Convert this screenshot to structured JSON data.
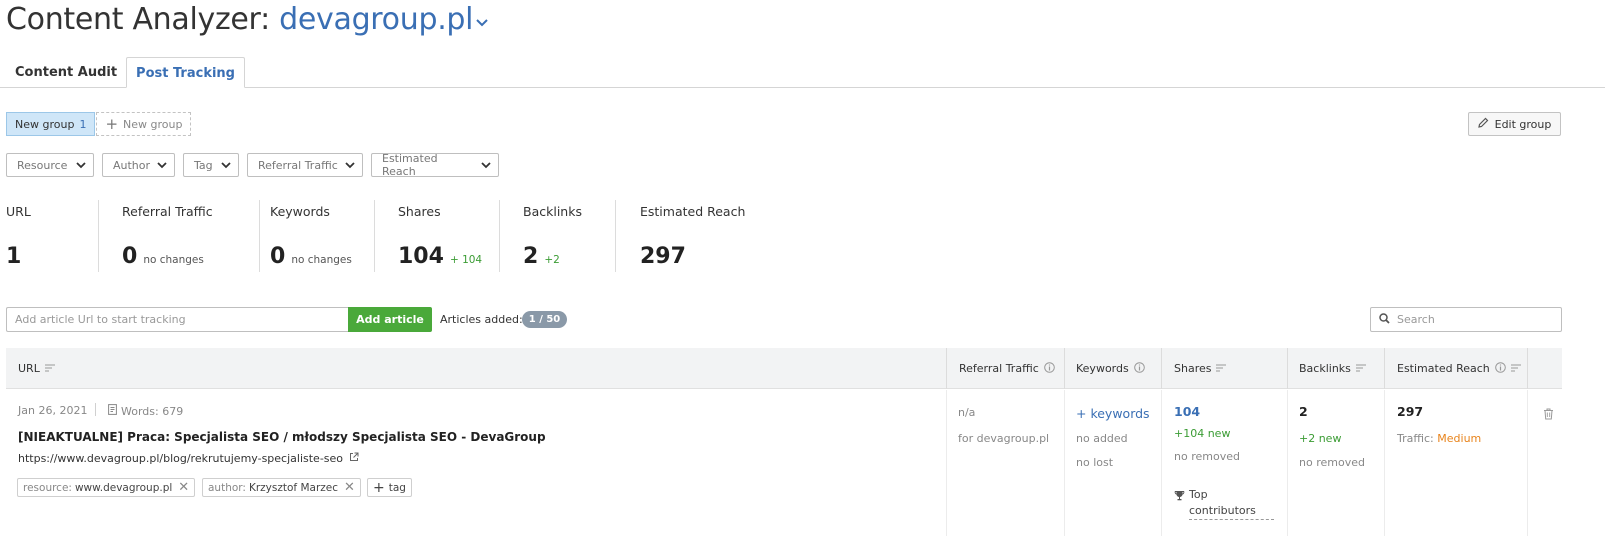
{
  "header": {
    "title_prefix": "Content Analyzer: ",
    "domain": "devagroup.pl"
  },
  "tabs": [
    {
      "label": "Content Audit",
      "active": false
    },
    {
      "label": "Post Tracking",
      "active": true
    }
  ],
  "groups": {
    "active_label": "New group",
    "active_count": "1",
    "new_group_label": "New group"
  },
  "edit_group_label": "Edit group",
  "filters": [
    "Resource",
    "Author",
    "Tag",
    "Referral Traffic",
    "Estimated Reach"
  ],
  "stats": [
    {
      "label": "URL",
      "value": "1",
      "sub": ""
    },
    {
      "label": "Referral Traffic",
      "value": "0",
      "sub": "no changes"
    },
    {
      "label": "Keywords",
      "value": "0",
      "sub": "no changes"
    },
    {
      "label": "Shares",
      "value": "104",
      "sub": "+ 104"
    },
    {
      "label": "Backlinks",
      "value": "2",
      "sub": "+2"
    },
    {
      "label": "Estimated Reach",
      "value": "297",
      "sub": ""
    }
  ],
  "add_article": {
    "placeholder": "Add article Url to start tracking",
    "button_label": "Add article",
    "articles_added_label": "Articles added:",
    "articles_added_badge": "1 / 50"
  },
  "search": {
    "placeholder": "Search"
  },
  "table": {
    "columns": [
      "URL",
      "Referral Traffic",
      "Keywords",
      "Shares",
      "Backlinks",
      "Estimated Reach"
    ],
    "rows": [
      {
        "date": "Jan 26, 2021",
        "words": "Words: 679",
        "title": "[NIEAKTUALNE] Praca: Specjalista SEO / młodszy Specjalista SEO - DevaGroup",
        "url": "https://www.devagroup.pl/blog/rekrutujemy-specjaliste-seo",
        "tags": [
          {
            "key": "resource:",
            "value": "www.devagroup.pl"
          },
          {
            "key": "author:",
            "value": "Krzysztof Marzec"
          }
        ],
        "add_tag_label": "tag",
        "referral_traffic": "n/a",
        "referral_traffic_note": "for devagroup.pl",
        "keywords_link": "+ keywords",
        "keywords_added": "no added",
        "keywords_lost": "no lost",
        "shares": "104",
        "shares_new": "+104 new",
        "shares_removed": "no removed",
        "top_contributors": "Top contributors",
        "backlinks": "2",
        "backlinks_new": "+2 new",
        "backlinks_removed": "no removed",
        "reach": "297",
        "reach_traffic_label": "Traffic:",
        "reach_traffic_value": "Medium"
      }
    ]
  },
  "colors": {
    "accent": "#3a6fb4",
    "green": "#4aa93a",
    "orange": "#e8841c"
  }
}
